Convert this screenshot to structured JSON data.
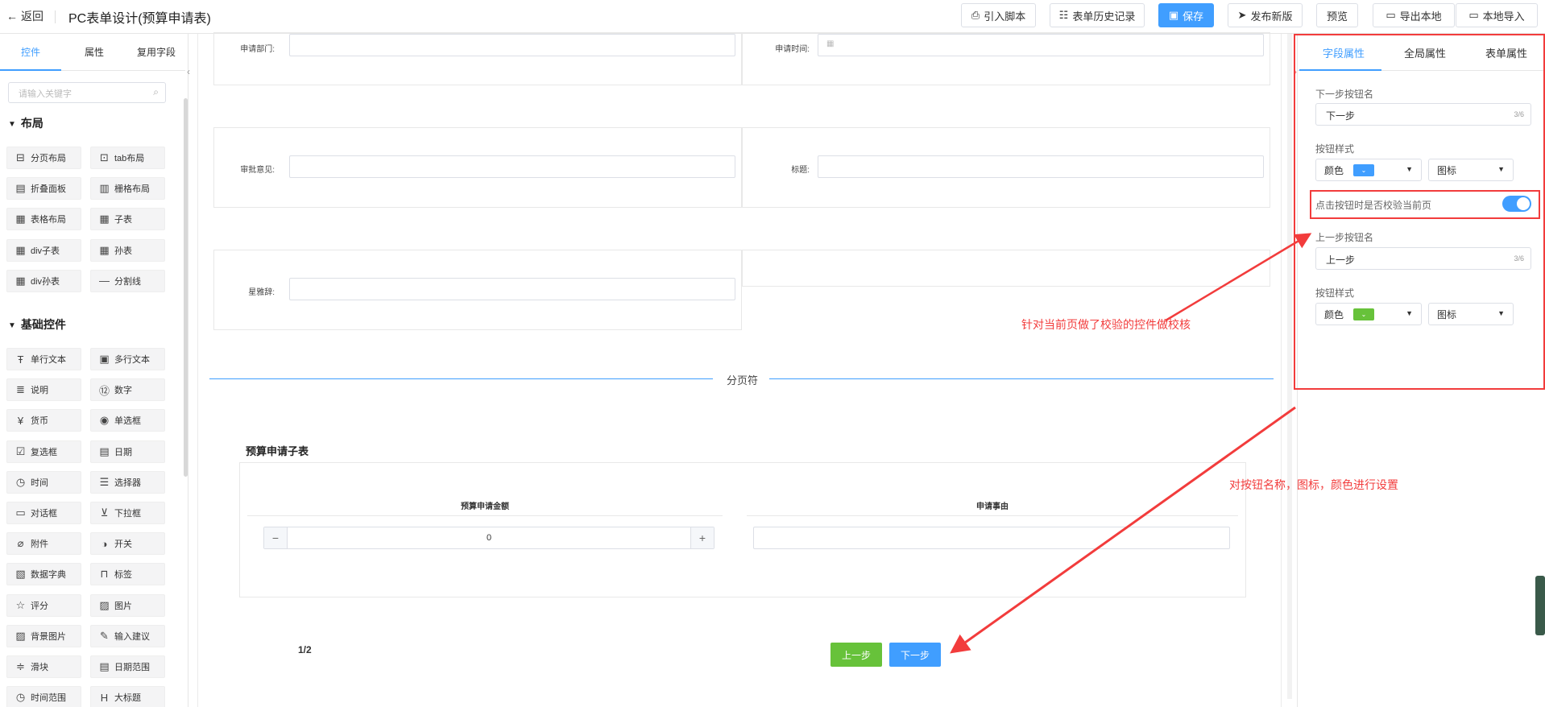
{
  "header": {
    "back_label": "返回",
    "title": "PC表单设计(预算申请表)",
    "buttons": {
      "import_script": "引入脚本",
      "history": "表单历史记录",
      "save": "保存",
      "publish": "发布新版",
      "preview": "预览",
      "export": "导出本地",
      "local_import": "本地导入"
    }
  },
  "left_panel": {
    "tabs": [
      "控件",
      "属性",
      "复用字段"
    ],
    "search_placeholder": "请输入关键字",
    "layout_section": "布局",
    "layout_items": [
      {
        "label": "分页布局",
        "icon": "page-layout-icon",
        "glyph": "⊟"
      },
      {
        "label": "tab布局",
        "icon": "tab-layout-icon",
        "glyph": "⊡"
      },
      {
        "label": "折叠面板",
        "icon": "collapse-panel-icon",
        "glyph": "▤"
      },
      {
        "label": "栅格布局",
        "icon": "grid-layout-icon",
        "glyph": "▥"
      },
      {
        "label": "表格布局",
        "icon": "table-layout-icon",
        "glyph": "▦"
      },
      {
        "label": "子表",
        "icon": "subtable-icon",
        "glyph": "▦"
      },
      {
        "label": "div子表",
        "icon": "div-subtable-icon",
        "glyph": "▦"
      },
      {
        "label": "孙表",
        "icon": "grandchild-table-icon",
        "glyph": "▦"
      },
      {
        "label": "div孙表",
        "icon": "div-grandchild-table-icon",
        "glyph": "▦"
      },
      {
        "label": "分割线",
        "icon": "divider-icon",
        "glyph": "—"
      }
    ],
    "basic_section": "基础控件",
    "basic_items": [
      {
        "label": "单行文本",
        "icon": "single-line-text-icon",
        "glyph": "Ŧ"
      },
      {
        "label": "多行文本",
        "icon": "multi-line-text-icon",
        "glyph": "▣"
      },
      {
        "label": "说明",
        "icon": "description-icon",
        "glyph": "≣"
      },
      {
        "label": "数字",
        "icon": "number-icon",
        "glyph": "⑫"
      },
      {
        "label": "货币",
        "icon": "currency-icon",
        "glyph": "¥"
      },
      {
        "label": "单选框",
        "icon": "radio-icon",
        "glyph": "◉"
      },
      {
        "label": "复选框",
        "icon": "checkbox-icon",
        "glyph": "☑"
      },
      {
        "label": "日期",
        "icon": "date-icon",
        "glyph": "▤"
      },
      {
        "label": "时间",
        "icon": "time-icon",
        "glyph": "◷"
      },
      {
        "label": "选择器",
        "icon": "selector-icon",
        "glyph": "☰"
      },
      {
        "label": "对话框",
        "icon": "dialog-icon",
        "glyph": "▭"
      },
      {
        "label": "下拉框",
        "icon": "dropdown-icon",
        "glyph": "⊻"
      },
      {
        "label": "附件",
        "icon": "attachment-icon",
        "glyph": "⌀"
      },
      {
        "label": "开关",
        "icon": "switch-icon",
        "glyph": "◑"
      },
      {
        "label": "数据字典",
        "icon": "data-dictionary-icon",
        "glyph": "▧"
      },
      {
        "label": "标签",
        "icon": "tag-icon",
        "glyph": "⊓"
      },
      {
        "label": "评分",
        "icon": "rating-icon",
        "glyph": "☆"
      },
      {
        "label": "图片",
        "icon": "image-icon",
        "glyph": "▨"
      },
      {
        "label": "背景图片",
        "icon": "background-image-icon",
        "glyph": "▨"
      },
      {
        "label": "输入建议",
        "icon": "input-suggest-icon",
        "glyph": "✎"
      },
      {
        "label": "滑块",
        "icon": "slider-icon",
        "glyph": "≑"
      },
      {
        "label": "日期范围",
        "icon": "date-range-icon",
        "glyph": "▤"
      },
      {
        "label": "时间范围",
        "icon": "time-range-icon",
        "glyph": "◷"
      },
      {
        "label": "大标题",
        "icon": "heading-icon",
        "glyph": "H"
      }
    ]
  },
  "form": {
    "fields": {
      "dept_label": "申请部门:",
      "time_label": "申请时间:",
      "opinion_label": "审批意见:",
      "title_label": "标题:",
      "sign_label": "星雅辞:"
    },
    "page_break_label": "分页符",
    "subtable": {
      "title": "预算申请子表",
      "columns": [
        "预算申请金额",
        "申请事由"
      ],
      "amount_value": "0",
      "minus": "−",
      "plus": "+"
    },
    "page_indicator": "1/2",
    "prev_button": "上一步",
    "next_button": "下一步"
  },
  "right_panel": {
    "tabs": [
      "字段属性",
      "全局属性",
      "表单属性"
    ],
    "next_name_label": "下一步按钮名",
    "next_name_value": "下一步",
    "next_name_count": "3/6",
    "button_style_label_1": "按钮样式",
    "color_label": "颜色",
    "icon_label": "图标",
    "validate_label": "点击按钮时是否校验当前页",
    "validate_on": true,
    "prev_name_label": "上一步按钮名",
    "prev_name_value": "上一步",
    "prev_name_count": "3/6",
    "button_style_label_2": "按钮样式",
    "color_label_2": "颜色",
    "icon_label_2": "图标",
    "colors": {
      "next": "#409eff",
      "prev": "#67c23a"
    }
  },
  "annotations": {
    "note_validate": "针对当前页做了校验的控件做校核",
    "note_style": "对按钮名称，图标，颜色进行设置",
    "color": "#f23c3c"
  }
}
